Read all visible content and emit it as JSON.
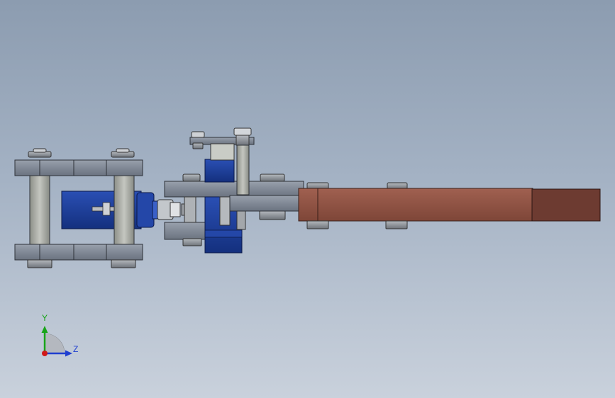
{
  "viewport": {
    "background_top": "#8c9cb0",
    "background_bottom": "#c9d1dc"
  },
  "model": {
    "parts": [
      {
        "name": "left-frame",
        "color": "#7f8794"
      },
      {
        "name": "left-servo-motor",
        "color": "#1e3f9c"
      },
      {
        "name": "standoff-pillars",
        "color": "#a7aaa4"
      },
      {
        "name": "center-bracket",
        "color": "#7f8794"
      },
      {
        "name": "center-servo-motor",
        "color": "#1e3f9c"
      },
      {
        "name": "vertical-shaft",
        "color": "#a7aaa4"
      },
      {
        "name": "right-arm-link",
        "color": "#8f5446"
      },
      {
        "name": "right-arm-end-block",
        "color": "#6d3b31"
      }
    ]
  },
  "triad": {
    "y_label": "Y",
    "z_label": "Z",
    "y_color": "#18a418",
    "z_color": "#1f3fd0",
    "x_color": "#d01818"
  }
}
